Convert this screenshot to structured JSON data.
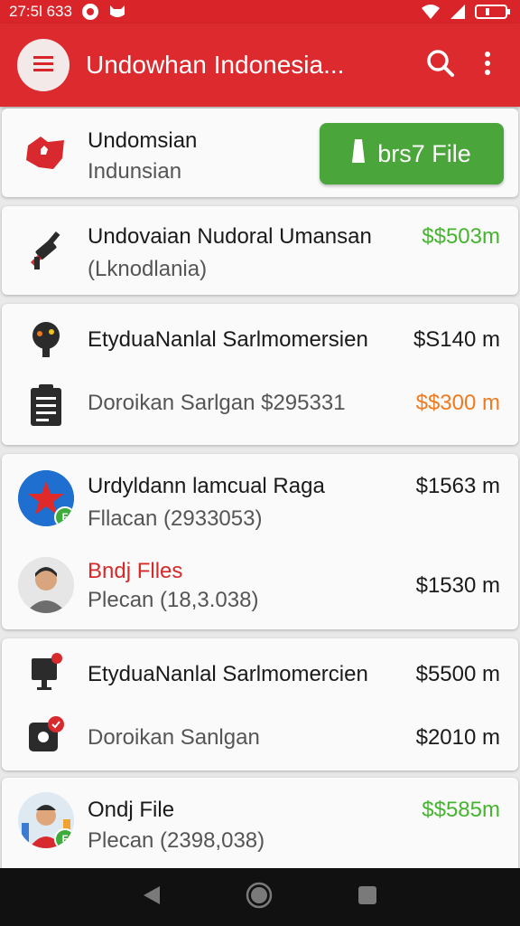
{
  "status_bar": {
    "time": "27:5l 633",
    "icons": [
      "app-notification-icon",
      "cat-icon",
      "wifi-icon",
      "signal-icon",
      "battery-icon"
    ]
  },
  "app_bar": {
    "title": "Undowhan Indonesia...",
    "icons": [
      "menu-icon",
      "search-icon",
      "more-vert-icon"
    ]
  },
  "header_card": {
    "title": "Undomsian",
    "subtitle": "Indunsian",
    "button_label": "brs7 File",
    "icon": "map-flag-icon"
  },
  "cards": [
    {
      "rows": [
        {
          "icon": "drill-icon",
          "title": "Undovaian Nudoral Umansan",
          "sub": "(Lknodlania)",
          "amount": "$$503m",
          "amount_color": "green"
        }
      ]
    },
    {
      "rows": [
        {
          "icon": "tree-icon",
          "title": "EtyduaNanlal Sarlmomersien",
          "sub": "",
          "amount": "$S140 m",
          "amount_color": "default"
        },
        {
          "icon": "clipboard-icon",
          "title": "",
          "sub": "Doroikan Sarlgan $295331",
          "amount": "$$300 m",
          "amount_color": "orange"
        }
      ]
    },
    {
      "rows": [
        {
          "icon": "star-globe-icon",
          "title": "Urdyldann lamcual Raga",
          "sub": "Fllacan (2933053)",
          "amount": "$1563 m",
          "amount_color": "default"
        },
        {
          "icon": "person-avatar-icon",
          "title": "Bndj Flles",
          "title_color": "red",
          "sub": "Plecan (18,3.038)",
          "amount": "$1530 m",
          "amount_color": "default"
        }
      ]
    },
    {
      "rows": [
        {
          "icon": "monitor-icon",
          "title": "EtyduaNanlal Sarlmomercien",
          "sub": "",
          "amount": "$5500 m",
          "amount_color": "default"
        },
        {
          "icon": "clock-badge-icon",
          "title": "",
          "sub": "Doroikan Sanlgan",
          "amount": "$2010 m",
          "amount_color": "default"
        }
      ]
    },
    {
      "rows": [
        {
          "icon": "person-avatar-icon",
          "title": "Ondj File",
          "sub": "Plecan (2398,038)",
          "amount": "$$585m",
          "amount_color": "green"
        }
      ]
    }
  ],
  "nav_bar": {
    "icons": [
      "back-icon",
      "home-icon",
      "recents-icon"
    ]
  }
}
